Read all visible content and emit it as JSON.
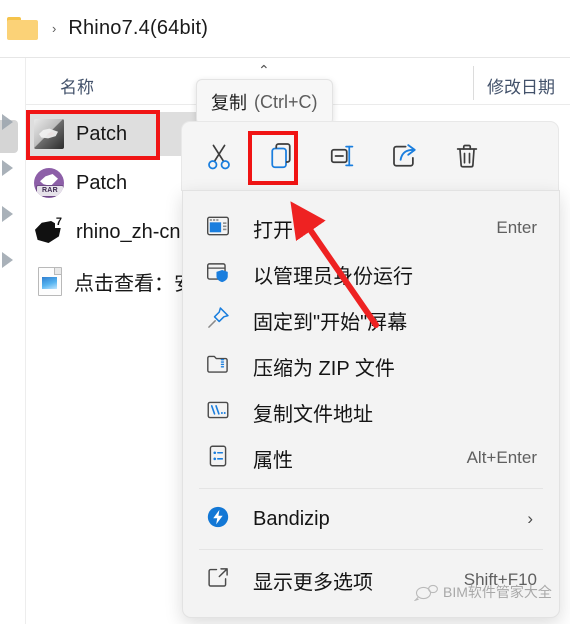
{
  "breadcrumb": {
    "folder_icon": "folder-icon",
    "chevron": "›",
    "path": "Rhino7.4(64bit)"
  },
  "columns": {
    "name": "名称",
    "date_modified": "修改日期"
  },
  "files": [
    {
      "name": "Patch",
      "icon": "rhino-exe-icon",
      "selected": true
    },
    {
      "name": "Patch",
      "icon": "winrar-archive-icon",
      "selected": false
    },
    {
      "name": "rhino_zh-cn",
      "icon": "7zip-archive-icon",
      "selected": false
    },
    {
      "name": "点击查看：安",
      "icon": "image-file-icon",
      "selected": false
    }
  ],
  "tooltip": {
    "caret": "⌃",
    "label": "复制",
    "shortcut": "(Ctrl+C)"
  },
  "toolbar": {
    "buttons": [
      {
        "name": "cut",
        "label": "剪切",
        "selected": false
      },
      {
        "name": "copy",
        "label": "复制",
        "selected": true
      },
      {
        "name": "rename",
        "label": "重命名",
        "selected": false
      },
      {
        "name": "share",
        "label": "共享",
        "selected": false
      },
      {
        "name": "delete",
        "label": "删除",
        "selected": false
      }
    ]
  },
  "context_menu": {
    "items": [
      {
        "label": "打开",
        "accel": "Enter",
        "icon": "open-window-icon",
        "submenu": false
      },
      {
        "label": "以管理员身份运行",
        "accel": "",
        "icon": "shield-admin-icon",
        "submenu": false
      },
      {
        "label": "固定到\"开始\"屏幕",
        "accel": "",
        "icon": "pin-icon",
        "submenu": false
      },
      {
        "label": "压缩为 ZIP 文件",
        "accel": "",
        "icon": "zip-folder-icon",
        "submenu": false
      },
      {
        "label": "复制文件地址",
        "accel": "",
        "icon": "copy-path-icon",
        "submenu": false
      },
      {
        "label": "属性",
        "accel": "Alt+Enter",
        "icon": "properties-icon",
        "submenu": false
      }
    ],
    "apps": [
      {
        "label": "Bandizip",
        "accel": "",
        "icon": "bandizip-icon",
        "submenu": true,
        "chevron": "›"
      }
    ],
    "more": {
      "label": "显示更多选项",
      "accel": "Shift+F10",
      "icon": "show-more-options-icon",
      "submenu": false
    }
  },
  "annotations": {
    "highlight_color": "#f01414",
    "arrow_color": "#ee2222",
    "selected_file_box": "Patch",
    "selected_toolbar_box": "copy"
  },
  "watermark": {
    "text": "BIM软件管家大全"
  }
}
